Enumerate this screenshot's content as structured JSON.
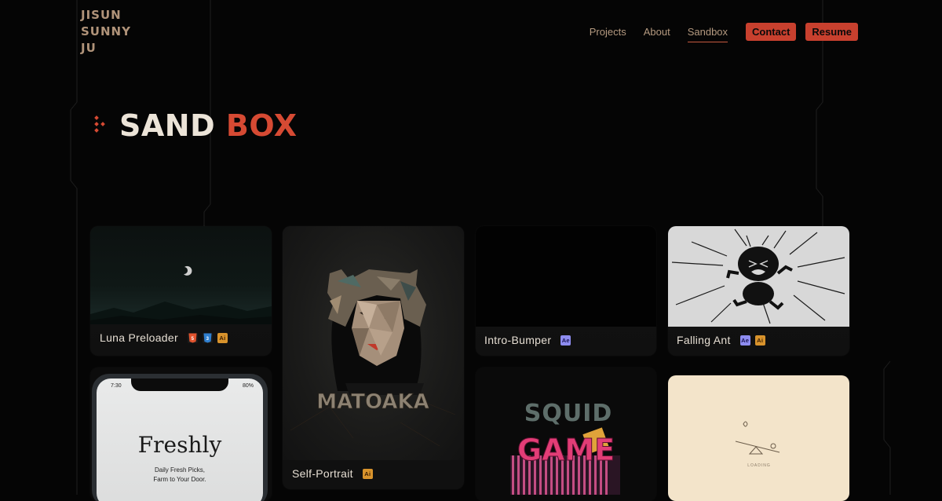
{
  "logo": {
    "lines": [
      "JISUN",
      "SUNNY",
      "JU"
    ]
  },
  "nav": {
    "links": [
      "Projects",
      "About",
      "Sandbox"
    ],
    "active": "Sandbox",
    "contact_label": "Contact",
    "resume_label": "Resume"
  },
  "page": {
    "title_part1": "SAND",
    "title_part2": "BOX"
  },
  "colors": {
    "accent": "#d64a33",
    "nav_text": "#b59a80",
    "background": "#050505"
  },
  "cards": [
    {
      "title": "Luna Preloader",
      "badges": [
        "html5-icon",
        "css3-icon",
        "Ai"
      ]
    },
    {
      "title": "Self-Portrait",
      "badges": [
        "Ai"
      ],
      "artwork_text": "MATOAKA"
    },
    {
      "title": "Intro-Bumper",
      "badges": [
        "Ae"
      ]
    },
    {
      "title": "Falling Ant",
      "badges": [
        "Ae",
        "Ai"
      ]
    },
    {
      "title": "",
      "phone": {
        "time": "7:30",
        "battery": "80%",
        "brand": "Freshly",
        "tagline_1": "Daily Fresh Picks,",
        "tagline_2": "Farm to Your Door."
      }
    },
    {
      "title": "",
      "artwork_text_1": "SQUID",
      "artwork_text_2": "GAME"
    },
    {
      "title": "",
      "loading_text": "LOADING"
    }
  ],
  "badge_labels": {
    "ai": "Ai",
    "ae": "Ae",
    "html": "5",
    "css": "3"
  }
}
